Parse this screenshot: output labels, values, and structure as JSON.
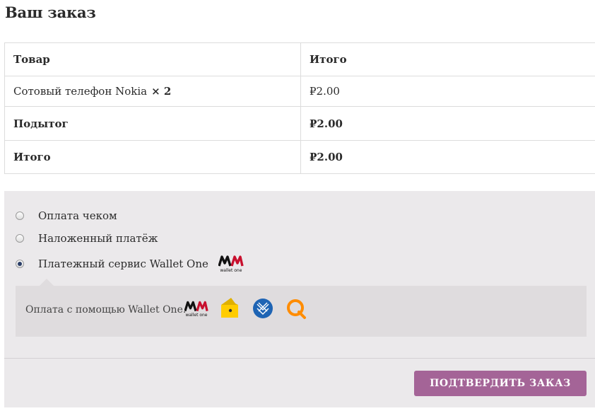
{
  "title": "Ваш заказ",
  "table": {
    "headers": {
      "product": "Товар",
      "total": "Итого"
    },
    "items": [
      {
        "name": "Сотовый телефон Nokia",
        "qty": "× 2",
        "total": "₽2.00"
      }
    ],
    "subtotal": {
      "label": "Подытог",
      "value": "₽2.00"
    },
    "total": {
      "label": "Итого",
      "value": "₽2.00"
    }
  },
  "payment": {
    "methods": [
      {
        "label": "Оплата чеком",
        "selected": false
      },
      {
        "label": "Наложенный платёж",
        "selected": false
      },
      {
        "label": "Платежный сервис Wallet One",
        "selected": true
      }
    ],
    "wallet_logo": {
      "mark": "W1",
      "caption": "wallet one"
    },
    "description": "Оплата с помощью Wallet One.",
    "icons": [
      "wallet-one-icon",
      "yandex-money-icon",
      "webmoney-icon",
      "qiwi-icon"
    ],
    "confirm_label": "ПОДТВЕРДИТЬ ЗАКАЗ"
  },
  "colors": {
    "button": "#a46497",
    "payment_bg": "#ebe9eb",
    "description_bg": "#dfdcde",
    "wallet_red": "#c8102e",
    "yandex_yellow": "#ffcc00",
    "webmoney_blue": "#1e64b4",
    "qiwi_orange": "#ff8c00"
  }
}
